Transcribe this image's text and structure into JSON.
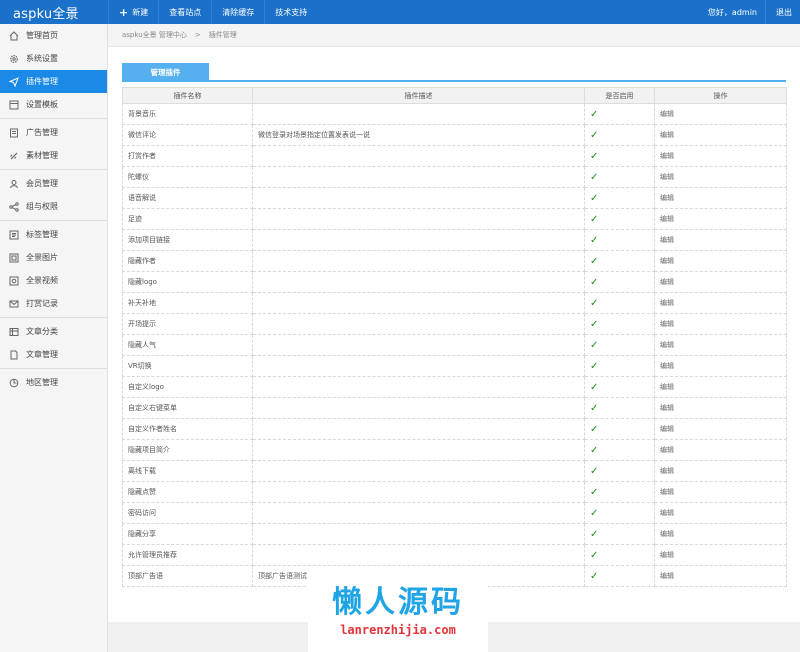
{
  "topbar": {
    "logo": "aspku全景",
    "nav": [
      "新建",
      "查看站点",
      "清除缓存",
      "技术支持"
    ],
    "greeting": "您好，admin",
    "logout": "退出"
  },
  "sidebar": {
    "groups": [
      [
        {
          "label": "管理首页",
          "icon": "home-icon"
        },
        {
          "label": "系统设置",
          "icon": "gear-icon"
        },
        {
          "label": "插件管理",
          "icon": "send-icon",
          "active": true
        },
        {
          "label": "设置模板",
          "icon": "template-icon"
        }
      ],
      [
        {
          "label": "广告管理",
          "icon": "ad-icon"
        },
        {
          "label": "素材管理",
          "icon": "link-icon"
        }
      ],
      [
        {
          "label": "会员管理",
          "icon": "user-icon"
        },
        {
          "label": "组与权限",
          "icon": "share-icon"
        }
      ],
      [
        {
          "label": "标签管理",
          "icon": "tag-icon"
        },
        {
          "label": "全景图片",
          "icon": "image-icon"
        },
        {
          "label": "全景视频",
          "icon": "video-icon"
        },
        {
          "label": "打赏记录",
          "icon": "mail-icon"
        }
      ],
      [
        {
          "label": "文章分类",
          "icon": "category-icon"
        },
        {
          "label": "文章管理",
          "icon": "file-icon"
        }
      ],
      [
        {
          "label": "地区管理",
          "icon": "map-icon"
        }
      ]
    ]
  },
  "breadcrumb": {
    "root": "aspku全景 管理中心",
    "separator": ">",
    "current": "插件管理"
  },
  "tab": {
    "label": "管理插件"
  },
  "table": {
    "headers": [
      "插件名称",
      "插件描述",
      "是否启用",
      "操作"
    ],
    "rows": [
      {
        "name": "背景音乐",
        "desc": "",
        "enabled": "✓",
        "action": "编辑"
      },
      {
        "name": "微信评论",
        "desc": "微信登录对场景指定位置发表说一说",
        "enabled": "✓",
        "action": "编辑"
      },
      {
        "name": "打赏作者",
        "desc": "",
        "enabled": "✓",
        "action": "编辑"
      },
      {
        "name": "陀螺仪",
        "desc": "",
        "enabled": "✓",
        "action": "编辑"
      },
      {
        "name": "语音解说",
        "desc": "",
        "enabled": "✓",
        "action": "编辑"
      },
      {
        "name": "足迹",
        "desc": "",
        "enabled": "✓",
        "action": "编辑"
      },
      {
        "name": "添加项目链接",
        "desc": "",
        "enabled": "✓",
        "action": "编辑"
      },
      {
        "name": "隐藏作者",
        "desc": "",
        "enabled": "✓",
        "action": "编辑"
      },
      {
        "name": "隐藏logo",
        "desc": "",
        "enabled": "✓",
        "action": "编辑"
      },
      {
        "name": "补天补地",
        "desc": "",
        "enabled": "✓",
        "action": "编辑"
      },
      {
        "name": "开场提示",
        "desc": "",
        "enabled": "✓",
        "action": "编辑"
      },
      {
        "name": "隐藏人气",
        "desc": "",
        "enabled": "✓",
        "action": "编辑"
      },
      {
        "name": "VR切换",
        "desc": "",
        "enabled": "✓",
        "action": "编辑"
      },
      {
        "name": "自定义logo",
        "desc": "",
        "enabled": "✓",
        "action": "编辑"
      },
      {
        "name": "自定义右键菜单",
        "desc": "",
        "enabled": "✓",
        "action": "编辑"
      },
      {
        "name": "自定义作者姓名",
        "desc": "",
        "enabled": "✓",
        "action": "编辑"
      },
      {
        "name": "隐藏项目简介",
        "desc": "",
        "enabled": "✓",
        "action": "编辑"
      },
      {
        "name": "离线下载",
        "desc": "",
        "enabled": "✓",
        "action": "编辑"
      },
      {
        "name": "隐藏点赞",
        "desc": "",
        "enabled": "✓",
        "action": "编辑"
      },
      {
        "name": "密码访问",
        "desc": "",
        "enabled": "✓",
        "action": "编辑"
      },
      {
        "name": "隐藏分享",
        "desc": "",
        "enabled": "✓",
        "action": "编辑"
      },
      {
        "name": "允许管理员推荐",
        "desc": "",
        "enabled": "✓",
        "action": "编辑"
      },
      {
        "name": "顶部广告语",
        "desc": "顶部广告语测试",
        "enabled": "✓",
        "action": "编辑"
      }
    ]
  },
  "watermark": {
    "big": "懒人源码",
    "small": "lanrenzhijia.com"
  },
  "colors": {
    "topbar": "#1b71c9",
    "active": "#1b8ae6",
    "tab": "#56b0f0",
    "check": "#1a8f1a"
  }
}
